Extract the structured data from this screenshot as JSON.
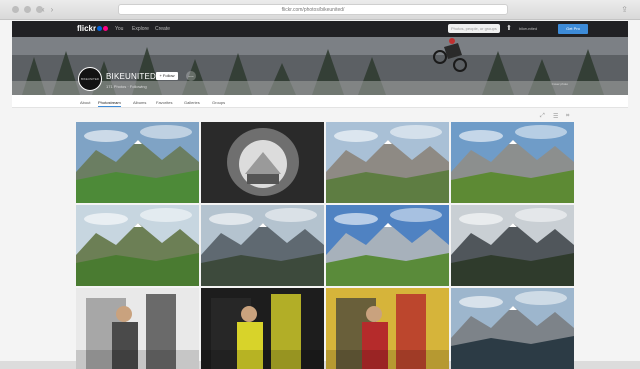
{
  "browser": {
    "url": "flickr.com/photos/bikeunited/"
  },
  "topnav": {
    "logo": "flickr",
    "links": [
      "You",
      "Explore",
      "Create"
    ],
    "search_placeholder": "Photos, people, or groups",
    "user_label": "bikeunited",
    "pro_label": "Get Pro"
  },
  "profile": {
    "avatar_text": "BIKEUNITED",
    "name": "BIKEUNITED",
    "follow_label": "+ Follow",
    "more_label": "…",
    "stats": "171 Photos · Following",
    "cover_credit": "Cover photo"
  },
  "subnav": {
    "tabs": [
      "About",
      "Photostream",
      "Albums",
      "Favorites",
      "Galleries",
      "Groups"
    ],
    "active_index": 1
  },
  "tools": [
    "⤢",
    "☰",
    "⌗"
  ],
  "photos": [
    {
      "kind": "valley",
      "sky": "#7fa3c5",
      "mtn": "#6b7e62",
      "ground": "#4d8a38"
    },
    {
      "kind": "tunnel",
      "sky": "#dcdcdc",
      "mtn": "#6f6f6f",
      "ground": "#2a2a2a"
    },
    {
      "kind": "valley",
      "sky": "#a9c0d6",
      "mtn": "#8e8a84",
      "ground": "#5e7d42"
    },
    {
      "kind": "valley",
      "sky": "#6f9cc8",
      "mtn": "#8c8f8e",
      "ground": "#5d8a34"
    },
    {
      "kind": "valley",
      "sky": "#c7d6e0",
      "mtn": "#6c7f55",
      "ground": "#4a7b31"
    },
    {
      "kind": "valley",
      "sky": "#b4c3cf",
      "mtn": "#5f6971",
      "ground": "#3d4a3c"
    },
    {
      "kind": "valley",
      "sky": "#4f82c2",
      "mtn": "#a7b1bb",
      "ground": "#5a8b3a"
    },
    {
      "kind": "valley",
      "sky": "#c9cfd4",
      "mtn": "#50565b",
      "ground": "#2f3b2c"
    },
    {
      "kind": "people",
      "sky": "#e9e9e9",
      "mtn": "#4a4a4a",
      "ground": "#8a8a8a"
    },
    {
      "kind": "people",
      "sky": "#1d1d1d",
      "mtn": "#d8d32a",
      "ground": "#2c2c2c"
    },
    {
      "kind": "people",
      "sky": "#d6b43a",
      "mtn": "#b52b2b",
      "ground": "#3b3b3b"
    },
    {
      "kind": "valley",
      "sky": "#9db6cd",
      "mtn": "#7d8389",
      "ground": "#2c3b45"
    }
  ]
}
